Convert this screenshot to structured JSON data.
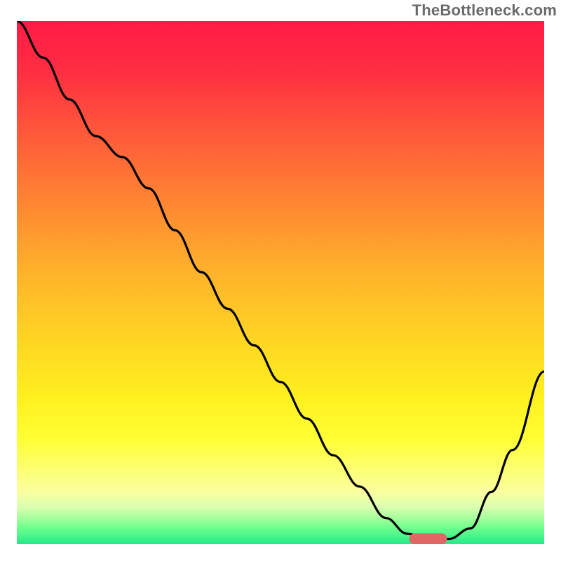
{
  "watermark": "TheBottleneck.com",
  "chart_data": {
    "type": "line",
    "title": "",
    "xlabel": "",
    "ylabel": "",
    "xlim": [
      0,
      100
    ],
    "ylim": [
      0,
      100
    ],
    "x": [
      0,
      5,
      10,
      15,
      20,
      25,
      30,
      35,
      40,
      45,
      50,
      55,
      60,
      65,
      70,
      74,
      78,
      82,
      86,
      90,
      94,
      100
    ],
    "values": [
      100,
      93,
      85,
      78,
      74,
      68,
      60,
      52,
      45,
      38,
      31,
      24,
      17,
      11,
      5,
      2,
      1,
      1,
      3,
      10,
      18,
      33
    ],
    "background_gradient_stops": [
      {
        "pos": 0,
        "color": "#ff1a47"
      },
      {
        "pos": 22,
        "color": "#ff5b3a"
      },
      {
        "pos": 48,
        "color": "#ffb22b"
      },
      {
        "pos": 72,
        "color": "#fff01f"
      },
      {
        "pos": 90,
        "color": "#fbffa0"
      },
      {
        "pos": 100,
        "color": "#24e98a"
      }
    ],
    "marker": {
      "x": 78,
      "y": 1,
      "color": "#e06666"
    },
    "series": [
      {
        "name": "bottleneck",
        "values_ref": "values"
      }
    ]
  }
}
